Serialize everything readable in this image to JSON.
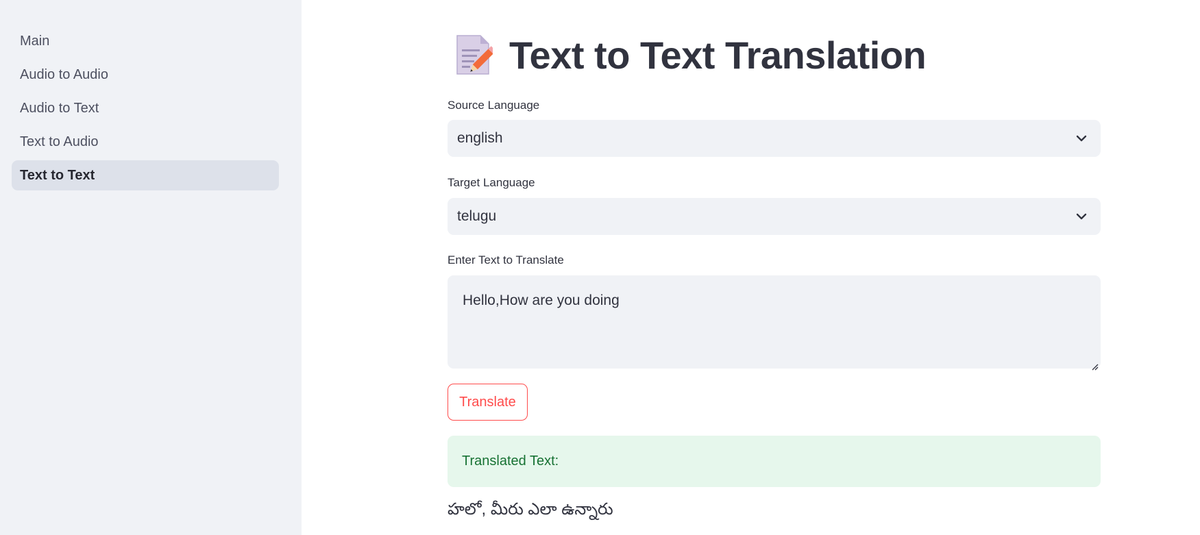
{
  "sidebar": {
    "items": [
      {
        "label": "Main",
        "active": false
      },
      {
        "label": "Audio to Audio",
        "active": false
      },
      {
        "label": "Audio to Text",
        "active": false
      },
      {
        "label": "Text to Audio",
        "active": false
      },
      {
        "label": "Text to Text",
        "active": true
      }
    ]
  },
  "main": {
    "title": "Text to Text Translation",
    "title_icon": "memo-icon",
    "source_language": {
      "label": "Source Language",
      "value": "english"
    },
    "target_language": {
      "label": "Target Language",
      "value": "telugu"
    },
    "input_text": {
      "label": "Enter Text to Translate",
      "value": "Hello,How are you doing"
    },
    "translate_button": "Translate",
    "result_label": "Translated Text:",
    "result_text": "హలో, మీరు ఎలా ఉన్నారు"
  },
  "colors": {
    "accent": "#ff4b4b",
    "sidebar_bg": "#f0f2f6",
    "success_bg": "#e6f7ec",
    "success_text": "#177233"
  }
}
